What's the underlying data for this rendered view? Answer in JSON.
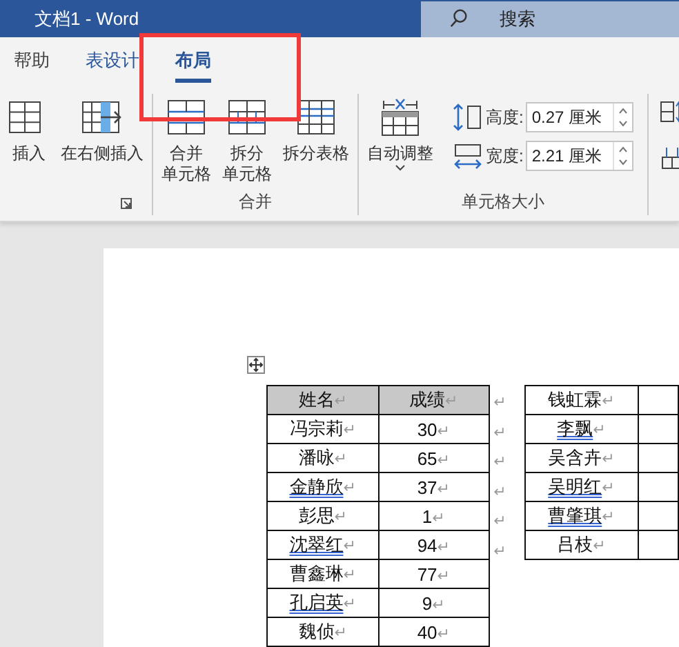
{
  "window": {
    "title": "文档1 - Word"
  },
  "search": {
    "placeholder": "搜索"
  },
  "tabs": [
    {
      "label": "帮助",
      "selected": false
    },
    {
      "label": "表设计",
      "selected": false
    },
    {
      "label": "布局",
      "selected": true
    }
  ],
  "ribbon": {
    "groups": [
      {
        "launcher": true,
        "buttons": [
          {
            "kind": "insert-left",
            "lines": [
              "插入"
            ]
          },
          {
            "kind": "insert-right",
            "lines": [
              "在右侧插入"
            ]
          }
        ]
      },
      {
        "label": "合并",
        "buttons": [
          {
            "kind": "merge",
            "lines": [
              "合并",
              "单元格"
            ]
          },
          {
            "kind": "split-cells",
            "lines": [
              "拆分",
              "单元格"
            ]
          },
          {
            "kind": "split-table",
            "lines": [
              "拆分表格"
            ]
          }
        ]
      },
      {
        "label": "单元格大小",
        "buttons": [
          {
            "kind": "autofit",
            "lines": [
              "自动调整"
            ],
            "dropdown": true
          }
        ],
        "fields": [
          {
            "kind": "height",
            "label": "高度:",
            "value": "0.27 厘米"
          },
          {
            "kind": "width",
            "label": "宽度:",
            "value": "2.21 厘米"
          }
        ]
      }
    ]
  },
  "document": {
    "tables": [
      {
        "rows": [
          {
            "header": true,
            "end_mark": "↵",
            "cells": [
              {
                "text": "姓名",
                "mark": "↵",
                "underlined": false
              },
              {
                "text": "成绩",
                "mark": "↵",
                "underlined": false
              }
            ]
          },
          {
            "header": false,
            "end_mark": "↵",
            "cells": [
              {
                "text": "冯宗莉",
                "mark": "↵",
                "underlined": false
              },
              {
                "text": "30",
                "mark": "↵",
                "underlined": false
              }
            ]
          },
          {
            "header": false,
            "end_mark": "↵",
            "cells": [
              {
                "text": "潘咏",
                "mark": "↵",
                "underlined": false
              },
              {
                "text": "65",
                "mark": "↵",
                "underlined": false
              }
            ]
          },
          {
            "header": false,
            "end_mark": "↵",
            "cells": [
              {
                "text": "金静欣",
                "mark": "↵",
                "underlined": true
              },
              {
                "text": "37",
                "mark": "↵",
                "underlined": false
              }
            ]
          },
          {
            "header": false,
            "end_mark": "↵",
            "cells": [
              {
                "text": "彭思",
                "mark": "↵",
                "underlined": false
              },
              {
                "text": "1",
                "mark": "↵",
                "underlined": false
              }
            ]
          },
          {
            "header": false,
            "end_mark": "↵",
            "cells": [
              {
                "text": "沈翠红",
                "mark": "↵",
                "underlined": true
              },
              {
                "text": "94",
                "mark": "↵",
                "underlined": false
              }
            ]
          },
          {
            "header": false,
            "cells": [
              {
                "text": "曹鑫琳",
                "mark": "↵",
                "underlined": false
              },
              {
                "text": "77",
                "mark": "↵",
                "underlined": false
              }
            ]
          },
          {
            "header": false,
            "cells": [
              {
                "text": "孔启英",
                "mark": "↵",
                "underlined": true
              },
              {
                "text": "9",
                "mark": "↵",
                "underlined": false
              }
            ]
          },
          {
            "header": false,
            "cells": [
              {
                "text": "魏侦",
                "mark": "↵",
                "underlined": false
              },
              {
                "text": "40",
                "mark": "↵",
                "underlined": false
              }
            ]
          }
        ]
      },
      {
        "rows": [
          {
            "header": false,
            "cells": [
              {
                "text": "钱虹霖",
                "mark": "↵",
                "underlined": false
              },
              {}
            ]
          },
          {
            "header": false,
            "cells": [
              {
                "text": "李飘",
                "mark": "↵",
                "underlined": true
              },
              {}
            ]
          },
          {
            "header": false,
            "cells": [
              {
                "text": "吴含卉",
                "mark": "↵",
                "underlined": false
              },
              {}
            ]
          },
          {
            "header": false,
            "cells": [
              {
                "text": "吴明红",
                "mark": "↵",
                "underlined": true
              },
              {}
            ]
          },
          {
            "header": false,
            "cells": [
              {
                "text": "曹肇琪",
                "mark": "↵",
                "underlined": true
              },
              {}
            ]
          },
          {
            "header": false,
            "cells": [
              {
                "text": "吕枝",
                "mark": "↵",
                "underlined": false
              },
              {}
            ]
          }
        ]
      }
    ]
  }
}
